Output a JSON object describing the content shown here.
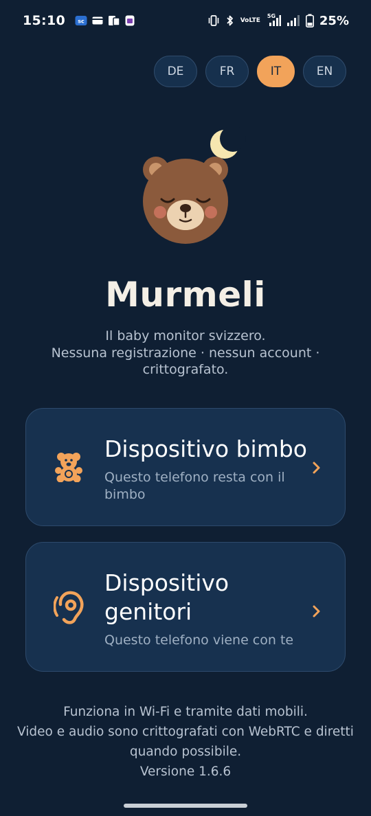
{
  "status_bar": {
    "time": "15:10",
    "battery_text": "25%",
    "network_label": "5G",
    "volte_top": "Vo",
    "volte_bottom": "LTE",
    "left_icons": [
      "sc-app-icon",
      "card-icon",
      "sim-icon",
      "app-icon"
    ],
    "right_icons": [
      "vibrate-icon",
      "bluetooth-icon",
      "volte-icon",
      "signal-5g-icon",
      "signal-icon",
      "battery-icon"
    ]
  },
  "languages": [
    {
      "code": "DE",
      "active": false
    },
    {
      "code": "FR",
      "active": false
    },
    {
      "code": "IT",
      "active": true
    },
    {
      "code": "EN",
      "active": false
    }
  ],
  "app": {
    "title": "Murmeli",
    "tagline_line1": "Il baby monitor svizzero.",
    "tagline_line2": "Nessuna registrazione · nessun account ·",
    "tagline_line3": "crittografato."
  },
  "options": {
    "child": {
      "title": "Dispositivo bimbo",
      "subtitle": "Questo telefono resta con il bimbo",
      "icon": "teddy-bear-icon"
    },
    "parent": {
      "title": "Dispositivo genitori",
      "subtitle": "Questo telefono viene con te",
      "icon": "ear-icon"
    }
  },
  "footer": {
    "line1": "Funziona in Wi-Fi e tramite dati mobili.",
    "line2": "Video e audio sono crittografati con WebRTC e diretti",
    "line3": "quando possibile.",
    "version": "Versione 1.6.6"
  },
  "colors": {
    "background": "#0f1f33",
    "card": "#17314f",
    "accent": "#f2a35a",
    "title": "#f4efe6",
    "bear_fur": "#8b5a3c",
    "moon": "#f6e7b0"
  }
}
